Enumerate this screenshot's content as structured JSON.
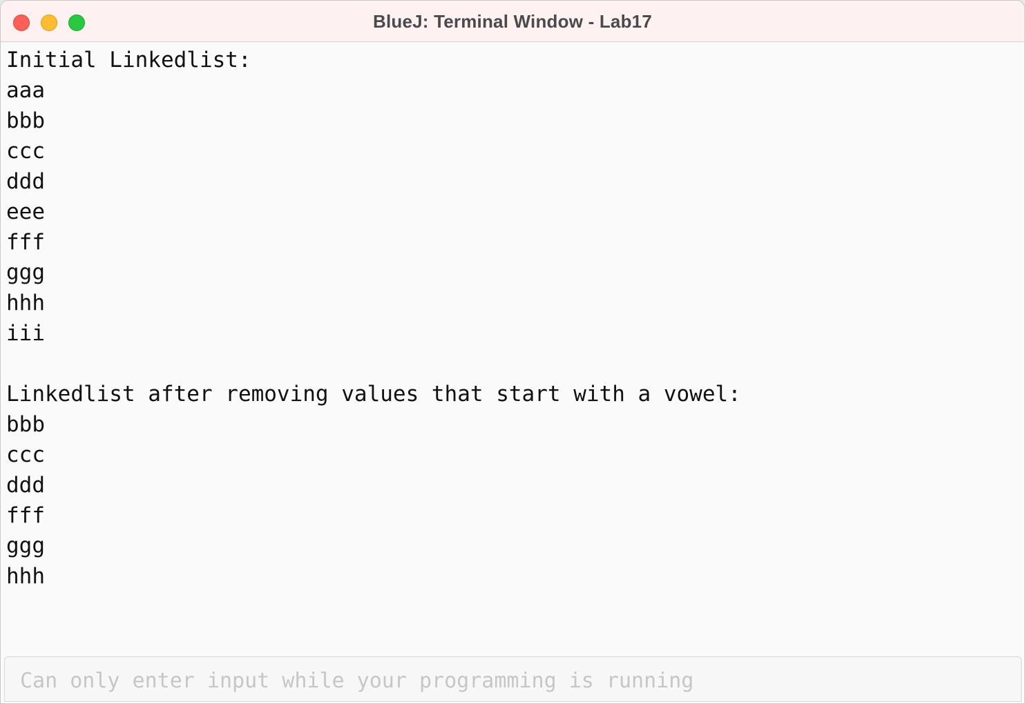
{
  "window": {
    "title": "BlueJ: Terminal Window - Lab17"
  },
  "terminal": {
    "lines": [
      "Initial Linkedlist:",
      "aaa",
      "bbb",
      "ccc",
      "ddd",
      "eee",
      "fff",
      "ggg",
      "hhh",
      "iii",
      "",
      "Linkedlist after removing values that start with a vowel:",
      "bbb",
      "ccc",
      "ddd",
      "fff",
      "ggg",
      "hhh"
    ],
    "input_placeholder": "Can only enter input while your programming is running"
  }
}
